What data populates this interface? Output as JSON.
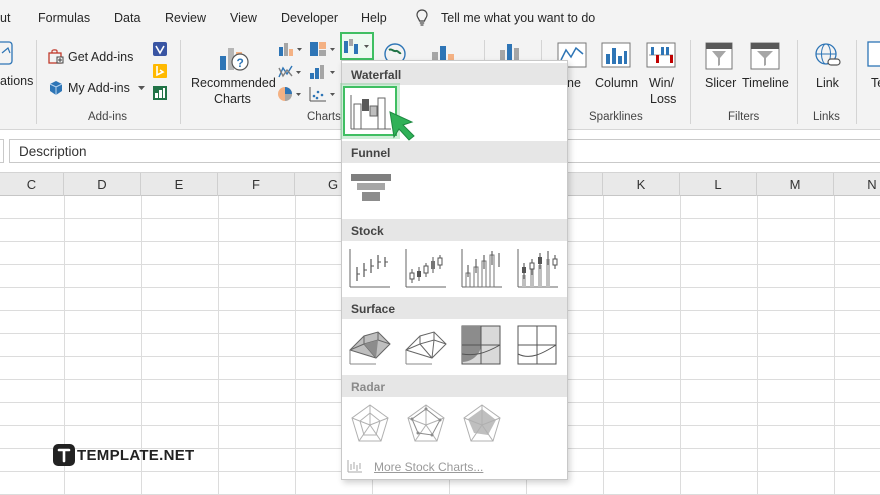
{
  "menu": {
    "items": [
      "ut",
      "Formulas",
      "Data",
      "Review",
      "View",
      "Developer",
      "Help"
    ],
    "tell_me": "Tell me what you want to do"
  },
  "ribbon": {
    "cut_label": "ations",
    "get_addins": "Get Add-ins",
    "my_addins": "My Add-ins",
    "addins_group": "Add-ins",
    "recommended_charts_line1": "Recommended",
    "recommended_charts_line2": "Charts",
    "charts_group": "Charts",
    "line_label": "ne",
    "column_label": "Column",
    "winloss_line1": "Win/",
    "winloss_line2": "Loss",
    "sparklines_group": "Sparklines",
    "slicer_label": "Slicer",
    "timeline_label": "Timeline",
    "filters_group": "Filters",
    "link_label": "Link",
    "links_group": "Links",
    "text_partial": "Te"
  },
  "formula_bar": {
    "value": "Description"
  },
  "columns": [
    "C",
    "D",
    "E",
    "F",
    "G",
    "",
    "",
    "",
    "K",
    "L",
    "M",
    "N"
  ],
  "dropdown": {
    "sections": {
      "waterfall": "Waterfall",
      "funnel": "Funnel",
      "stock": "Stock",
      "surface": "Surface",
      "radar": "Radar"
    },
    "more_link": "More Stock Charts..."
  },
  "watermark": {
    "text": "TEMPLATE.NET"
  },
  "colors": {
    "highlight": "#3fbf62",
    "ribbon_bg": "#f3f3f3",
    "header_bg": "#e6e6e6"
  }
}
